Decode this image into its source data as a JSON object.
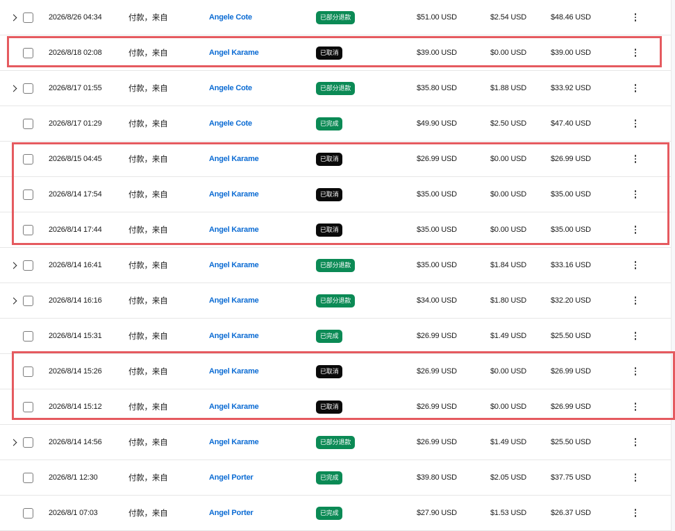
{
  "colors": {
    "link": "#0b6bd3",
    "badge_completed": "#0b8a55",
    "badge_partial_refund": "#0b8a55",
    "badge_cancelled": "#0a0a0a",
    "highlight": "#e55a5f"
  },
  "icons": {
    "expand": "chevron-right-icon",
    "more": "more-vertical-icon"
  },
  "rows": [
    {
      "expandable": true,
      "date": "2026/8/26 04:34",
      "type": "付款，来自",
      "customer": "Angele Cote",
      "status": "已部分退款",
      "status_kind": "green",
      "gross": "$51.00 USD",
      "fee": "$2.54 USD",
      "net": "$48.46 USD"
    },
    {
      "expandable": false,
      "date": "2026/8/18 02:08",
      "type": "付款，来自",
      "customer": "Angel Karame",
      "status": "已取消",
      "status_kind": "black",
      "gross": "$39.00 USD",
      "fee": "$0.00 USD",
      "net": "$39.00 USD"
    },
    {
      "expandable": true,
      "date": "2026/8/17 01:55",
      "type": "付款，来自",
      "customer": "Angele Cote",
      "status": "已部分退款",
      "status_kind": "green",
      "gross": "$35.80 USD",
      "fee": "$1.88 USD",
      "net": "$33.92 USD"
    },
    {
      "expandable": false,
      "date": "2026/8/17 01:29",
      "type": "付款，来自",
      "customer": "Angele Cote",
      "status": "已完成",
      "status_kind": "green",
      "gross": "$49.90 USD",
      "fee": "$2.50 USD",
      "net": "$47.40 USD"
    },
    {
      "expandable": false,
      "date": "2026/8/15 04:45",
      "type": "付款，来自",
      "customer": "Angel Karame",
      "status": "已取消",
      "status_kind": "black",
      "gross": "$26.99 USD",
      "fee": "$0.00 USD",
      "net": "$26.99 USD"
    },
    {
      "expandable": false,
      "date": "2026/8/14 17:54",
      "type": "付款，来自",
      "customer": "Angel Karame",
      "status": "已取消",
      "status_kind": "black",
      "gross": "$35.00 USD",
      "fee": "$0.00 USD",
      "net": "$35.00 USD"
    },
    {
      "expandable": false,
      "date": "2026/8/14 17:44",
      "type": "付款，来自",
      "customer": "Angel Karame",
      "status": "已取消",
      "status_kind": "black",
      "gross": "$35.00 USD",
      "fee": "$0.00 USD",
      "net": "$35.00 USD"
    },
    {
      "expandable": true,
      "date": "2026/8/14 16:41",
      "type": "付款，来自",
      "customer": "Angel Karame",
      "status": "已部分退款",
      "status_kind": "green",
      "gross": "$35.00 USD",
      "fee": "$1.84 USD",
      "net": "$33.16 USD"
    },
    {
      "expandable": true,
      "date": "2026/8/14 16:16",
      "type": "付款，来自",
      "customer": "Angel Karame",
      "status": "已部分退款",
      "status_kind": "green",
      "gross": "$34.00 USD",
      "fee": "$1.80 USD",
      "net": "$32.20 USD"
    },
    {
      "expandable": false,
      "date": "2026/8/14 15:31",
      "type": "付款，来自",
      "customer": "Angel Karame",
      "status": "已完成",
      "status_kind": "green",
      "gross": "$26.99 USD",
      "fee": "$1.49 USD",
      "net": "$25.50 USD"
    },
    {
      "expandable": false,
      "date": "2026/8/14 15:26",
      "type": "付款，来自",
      "customer": "Angel Karame",
      "status": "已取消",
      "status_kind": "black",
      "gross": "$26.99 USD",
      "fee": "$0.00 USD",
      "net": "$26.99 USD"
    },
    {
      "expandable": false,
      "date": "2026/8/14 15:12",
      "type": "付款，来自",
      "customer": "Angel Karame",
      "status": "已取消",
      "status_kind": "black",
      "gross": "$26.99 USD",
      "fee": "$0.00 USD",
      "net": "$26.99 USD"
    },
    {
      "expandable": true,
      "date": "2026/8/14 14:56",
      "type": "付款，来自",
      "customer": "Angel Karame",
      "status": "已部分退款",
      "status_kind": "green",
      "gross": "$26.99 USD",
      "fee": "$1.49 USD",
      "net": "$25.50 USD"
    },
    {
      "expandable": false,
      "date": "2026/8/1 12:30",
      "type": "付款，来自",
      "customer": "Angel Porter",
      "status": "已完成",
      "status_kind": "green",
      "gross": "$39.80 USD",
      "fee": "$2.05 USD",
      "net": "$37.75 USD"
    },
    {
      "expandable": false,
      "date": "2026/8/1 07:03",
      "type": "付款，来自",
      "customer": "Angel Porter",
      "status": "已完成",
      "status_kind": "green",
      "gross": "$27.90 USD",
      "fee": "$1.53 USD",
      "net": "$26.37 USD"
    }
  ]
}
